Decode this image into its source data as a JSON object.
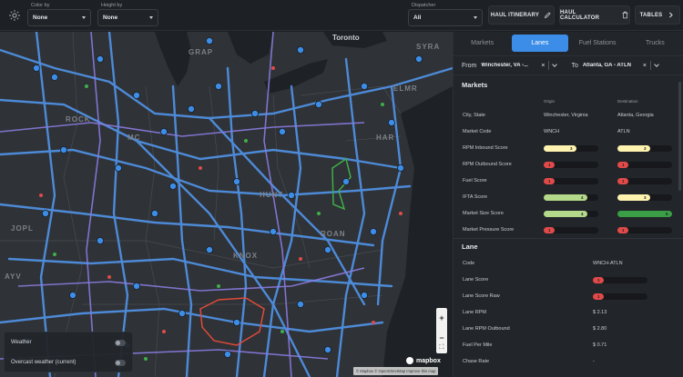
{
  "topbar": {
    "color_by": {
      "label": "Color by",
      "value": "None"
    },
    "height_by": {
      "label": "Height by",
      "value": "None"
    },
    "dispatcher": {
      "label": "Dispatcher",
      "value": "All"
    },
    "buttons": {
      "haul_itinerary": "HAUL ITINERARY",
      "haul_calculator": "HAUL CALCULATOR",
      "tables": "TABLES"
    }
  },
  "map": {
    "labels": {
      "toronto": "Toronto",
      "syra": "SYRA",
      "grap": "GRAP",
      "elmr": "ELMR",
      "rock": "ROCK",
      "mc": "MC",
      "harr": "HAR",
      "hunt": "HUNT",
      "knox": "KNOX",
      "jopl": "JOPL",
      "ayv": "AYV",
      "roan": "ROAN"
    },
    "weather": {
      "weather": "Weather",
      "overcast": "Overcast weather (current)"
    },
    "attribution": "© Mapbox © OpenStreetMap Improve this map",
    "brand": "mapbox",
    "zoom_in": "+",
    "zoom_out": "−"
  },
  "panel": {
    "tabs": [
      "Markets",
      "Lanes",
      "Fuel Stations",
      "Trucks"
    ],
    "active_tab": "Lanes",
    "from_label": "From",
    "from_value": "Winchester, VA -...",
    "to_label": "To",
    "to_value": "Atlanta, GA - ATLN",
    "markets_title": "Markets",
    "col_origin": "Origin",
    "col_destination": "Destination",
    "market_rows": [
      {
        "key": "City, State",
        "origin": "Winchester, Virginia",
        "dest": "Atlanta, Georgia"
      },
      {
        "key": "Market Code",
        "origin": "WNCH",
        "dest": "ATLN"
      }
    ],
    "score_rows": [
      {
        "key": "RPM Inbound Score",
        "o": "3",
        "of": 0.6,
        "oc": "#fff3b0",
        "d": "3",
        "df": 0.6,
        "dc": "#fff3b0"
      },
      {
        "key": "RPM Outbound Score",
        "o": "1",
        "of": 0.2,
        "oc": "#e24a4a",
        "d": "1",
        "df": 0.2,
        "dc": "#e24a4a"
      },
      {
        "key": "Fuel Score",
        "o": "1",
        "of": 0.2,
        "oc": "#e24a4a",
        "d": "1",
        "df": 0.2,
        "dc": "#e24a4a"
      },
      {
        "key": "IFTA Score",
        "o": "4",
        "of": 0.8,
        "oc": "#b5d98a",
        "d": "3",
        "df": 0.6,
        "dc": "#fff3b0"
      },
      {
        "key": "Market Size Score",
        "o": "4",
        "of": 0.8,
        "oc": "#b5d98a",
        "d": "5",
        "df": 1.0,
        "dc": "#3a9e47"
      },
      {
        "key": "Market Pressure Score",
        "o": "1",
        "of": 0.2,
        "oc": "#e24a4a",
        "d": "1",
        "df": 0.2,
        "dc": "#e24a4a"
      }
    ],
    "lane_title": "Lane",
    "lane_code": {
      "key": "Code",
      "value": "WNCH-ATLN"
    },
    "lane_score": {
      "key": "Lane Score",
      "value": "1",
      "fill": 0.2,
      "color": "#e24a4a"
    },
    "lane_score_raw": {
      "key": "Lane Score Raw",
      "value": "1",
      "fill": 0.2,
      "color": "#e24a4a"
    },
    "lane_rpm": {
      "key": "Lane RPM",
      "value": "$ 2.13"
    },
    "lane_rpm_out": {
      "key": "Lane RPM Outbound",
      "value": "$ 2.80"
    },
    "fuel_per_mile": {
      "key": "Fuel Per Mile",
      "value": "$ 0.71"
    },
    "chase_rate": {
      "key": "Chase Rate",
      "value": "-"
    }
  }
}
